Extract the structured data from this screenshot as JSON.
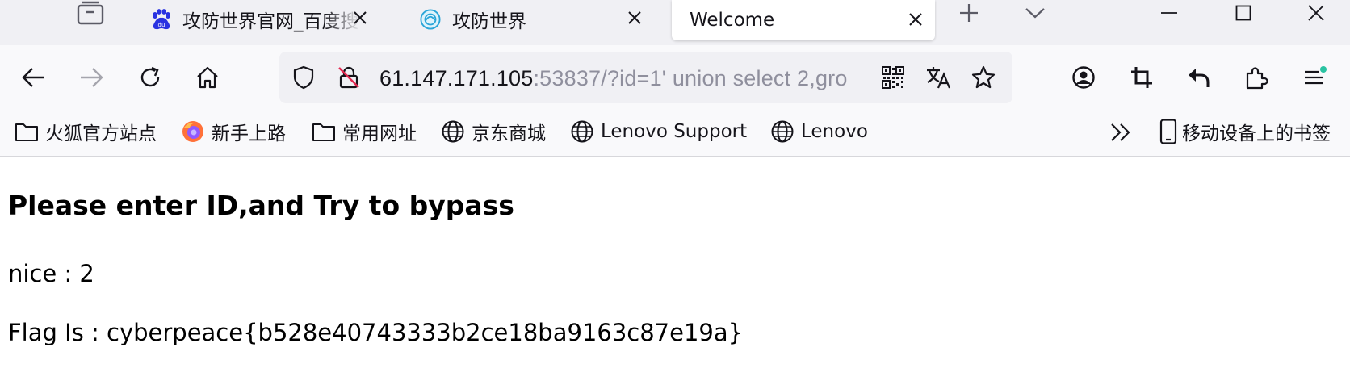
{
  "tabs": [
    {
      "title": "攻防世界官网_百度搜",
      "favicon": "baidu-icon",
      "active": false
    },
    {
      "title": "攻防世界",
      "favicon": "adworld-icon",
      "active": false
    },
    {
      "title": "Welcome",
      "favicon": "",
      "active": true
    }
  ],
  "nav": {
    "url_host": "61.147.171.105",
    "url_rest": ":53837/?id=1' union select 2,gro"
  },
  "bookmarks": [
    {
      "label": "火狐官方站点",
      "icon": "folder-icon"
    },
    {
      "label": "新手上路",
      "icon": "firefox-icon"
    },
    {
      "label": "常用网址",
      "icon": "folder-icon"
    },
    {
      "label": "京东商城",
      "icon": "globe-icon"
    },
    {
      "label": "Lenovo Support",
      "icon": "globe-icon"
    },
    {
      "label": "Lenovo",
      "icon": "globe-icon"
    }
  ],
  "mobile_bookmarks": "移动设备上的书签",
  "page": {
    "heading": "Please enter ID,and Try to bypass",
    "nice": "nice : 2",
    "flag": "Flag Is : cyberpeace{b528e40743333b2ce18ba9163c87e19a}"
  },
  "colors": {
    "tabstrip_bg": "#f0f0f4",
    "toolbar_bg": "#f9f9fb",
    "urlbar_bg": "#f0f0f4",
    "baidu_blue": "#2932e1",
    "notification_dot": "#2ac3a2"
  }
}
